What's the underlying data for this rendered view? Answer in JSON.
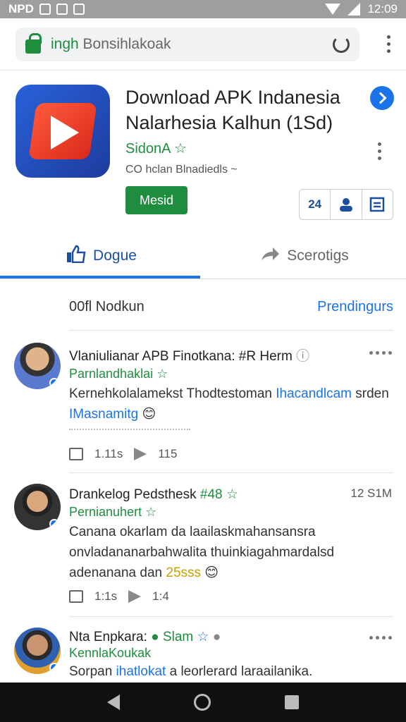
{
  "status": {
    "left": "NPD",
    "time": "12:09"
  },
  "browser": {
    "url_domain": "ingh",
    "url_rest": " Bonsihlakoak"
  },
  "app": {
    "title": "Download APK Indanesia Nalarhesia Kalhun (1Sd)",
    "developer": "SidonA",
    "meta": "CO hclan Blnadiedls ~",
    "install_label": "Mesid",
    "action_1": "24"
  },
  "tabs": [
    {
      "label": "Dogue"
    },
    {
      "label": "Scerotigs"
    }
  ],
  "section": {
    "left": "00fl Nodkun",
    "right": "Prendingurs"
  },
  "reviews": [
    {
      "name": "Vlaniulianar APB Finotkana: #R Herm",
      "sub": "Parnlandhaklai",
      "body_1": "Kernehkolalamekst Thodtestoman ",
      "body_hl": "Ihacandlcam",
      "body_2": " srden ",
      "body_hl2": "IMasnamitg",
      "likes": "1.11s",
      "shares": "115"
    },
    {
      "name": "Drankelog Pedsthesk",
      "tag": "#48",
      "time": "12 S1M",
      "sub": "Pernianuhert",
      "body_1": "Canana okarlam da laailaskmahansansra onvladananarbahwalita thuinkiagahmardalsd adenanana dan ",
      "body_em": "25sss",
      "likes": "1:1s",
      "shares": "1:4"
    },
    {
      "name": "Nta Enpkara:",
      "tag": "Slam",
      "sub": "KennlaKoukak",
      "body_1": "Sorpan ",
      "body_hl": "ihatlokat",
      "body_2": " a leorlerard laraailanika."
    }
  ]
}
